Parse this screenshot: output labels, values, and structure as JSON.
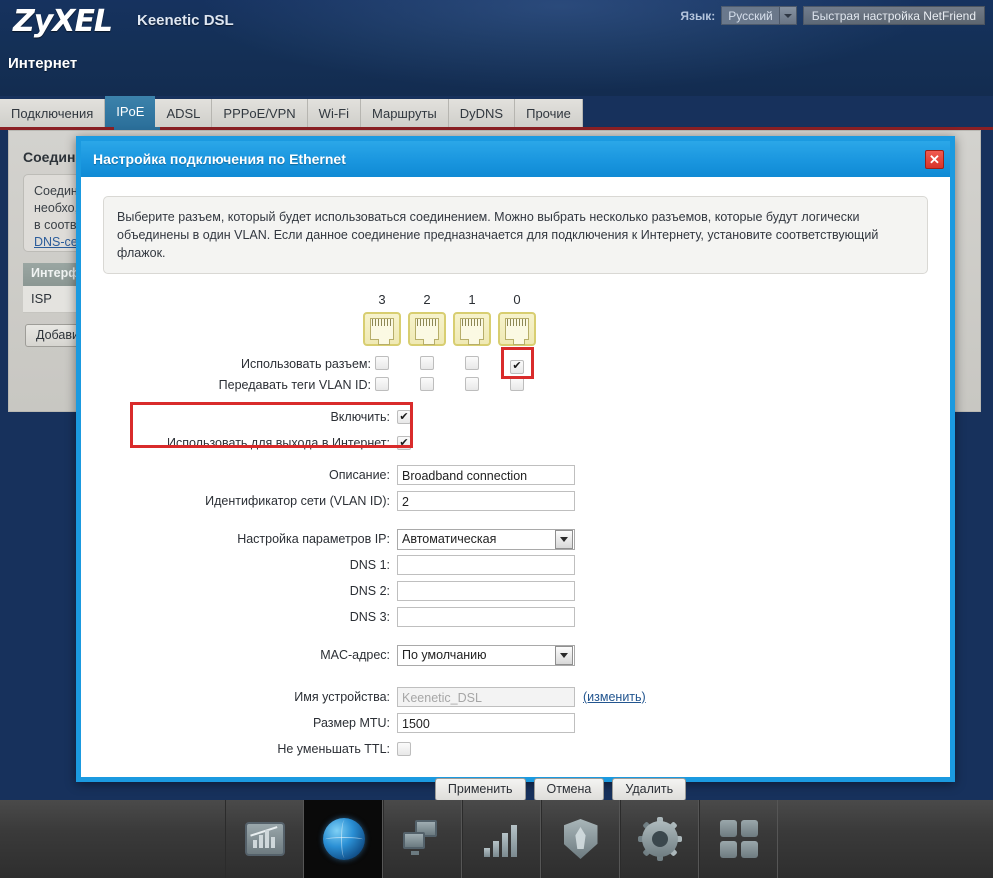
{
  "header": {
    "logo": "ZyXEL",
    "model": "Keenetic DSL",
    "lang_label": "Язык:",
    "lang_value": "Русский",
    "netfriend_button": "Быстрая настройка NetFriend",
    "page_title": "Интернет"
  },
  "tabs": [
    {
      "label": "Подключения",
      "active": false
    },
    {
      "label": "IPoE",
      "active": true
    },
    {
      "label": "ADSL",
      "active": false
    },
    {
      "label": "PPPoE/VPN",
      "active": false
    },
    {
      "label": "Wi-Fi",
      "active": false
    },
    {
      "label": "Маршруты",
      "active": false
    },
    {
      "label": "DyDNS",
      "active": false
    },
    {
      "label": "Прочие",
      "active": false
    }
  ],
  "background_page": {
    "title": "Соединения",
    "note_line1": "Соединения",
    "note_line2": "необхо,",
    "note_line3": "в соотв",
    "note_link": "DNS-се",
    "subheader": "Интерф",
    "row_value": "ISP",
    "add_button": "Добави"
  },
  "modal": {
    "title": "Настройка подключения по Ethernet",
    "close_icon": "✕",
    "info": "Выберите разъем, который будет использоваться соединением. Можно выбрать несколько разъемов, которые будут логически объединены в один VLAN. Если данное соединение предназначается для подключения к Интернету, установите соответствующий флажок.",
    "ports": {
      "numbers": [
        "3",
        "2",
        "1",
        "0"
      ],
      "use_port_label": "Использовать разъем:",
      "use_port_values": [
        false,
        false,
        false,
        true
      ],
      "vlan_tag_label": "Передавать теги VLAN ID:",
      "vlan_tag_values": [
        false,
        false,
        false,
        false
      ],
      "highlighted_port_index": 3
    },
    "flags": {
      "enable_label": "Включить:",
      "enable_value": true,
      "internet_label": "Использовать для выхода в Интернет:",
      "internet_value": true
    },
    "fields": {
      "description_label": "Описание:",
      "description_value": "Broadband connection",
      "vlan_id_label": "Идентификатор сети (VLAN ID):",
      "vlan_id_value": "2",
      "ip_settings_label": "Настройка параметров IP:",
      "ip_settings_value": "Автоматическая",
      "dns1_label": "DNS 1:",
      "dns1_value": "",
      "dns2_label": "DNS 2:",
      "dns2_value": "",
      "dns3_label": "DNS 3:",
      "dns3_value": "",
      "mac_label": "MAC-адрес:",
      "mac_value": "По умолчанию",
      "device_name_label": "Имя устройства:",
      "device_name_value": "Keenetic_DSL",
      "device_name_link": "(изменить)",
      "mtu_label": "Размер MTU:",
      "mtu_value": "1500",
      "ttl_label": "Не уменьшать TTL:",
      "ttl_value": false
    },
    "buttons": {
      "apply": "Применить",
      "cancel": "Отмена",
      "delete": "Удалить"
    }
  },
  "taskbar": {
    "items": [
      {
        "icon": "system-monitor-icon",
        "active": false
      },
      {
        "icon": "internet-globe-icon",
        "active": true
      },
      {
        "icon": "home-network-icon",
        "active": false
      },
      {
        "icon": "wifi-signal-icon",
        "active": false
      },
      {
        "icon": "firewall-shield-icon",
        "active": false
      },
      {
        "icon": "system-settings-gear-icon",
        "active": false
      },
      {
        "icon": "apps-grid-icon",
        "active": false
      }
    ]
  },
  "colors": {
    "header_blue": "#16325f",
    "tab_active": "#2b6f9a",
    "modal_border": "#1b9ae0",
    "modal_title_bg": "#1a96df",
    "highlight_red": "#d92b2b",
    "underline_red": "#8b2024",
    "port_yellow": "#f7f3cc"
  }
}
